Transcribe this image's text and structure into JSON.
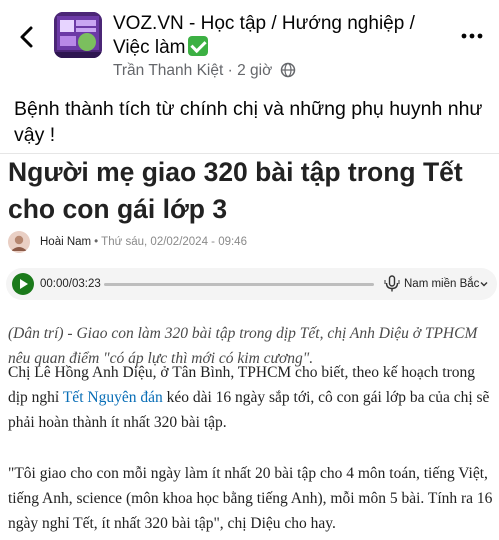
{
  "header": {
    "group_name": "VOZ.VN - Học tập / Hướng nghiệp / Việc làm",
    "author": "Trần Thanh Kiệt",
    "time": "2 giờ",
    "separator": "·"
  },
  "post": {
    "caption": "Bệnh thành tích từ chính chị và những phụ huynh như vậy !"
  },
  "article": {
    "title": "Người mẹ giao 320 bài tập trong Tết cho con gái lớp 3",
    "author": "Hoài Nam",
    "date": "Thứ sáu, 02/02/2024 - 09:46",
    "audio": {
      "time": "00:00/03:23",
      "voice": "Nam miền Bắc"
    },
    "lead": "(Dân trí) - Giao con làm 320 bài tập trong dịp Tết, chị Anh Diệu ở TPHCM nêu quan điểm \"có áp lực thì mới có kim cương\".",
    "p1_before": "Chị Lê Hồng Anh Diệu, ở Tân Bình, TPHCM cho biết, theo kế hoạch trong dịp nghỉ ",
    "p1_link": "Tết Nguyên đán",
    "p1_after": " kéo dài 16 ngày sắp tới, cô con gái lớp ba của chị sẽ phải hoàn thành ít nhất 320 bài tập.",
    "p2": "\"Tôi giao cho con mỗi ngày làm ít nhất 20 bài tập cho 4 môn toán, tiếng Việt, tiếng Anh, science (môn khoa học bằng tiếng Anh), mỗi môn 5 bài. Tính ra 16 ngày nghỉ Tết, ít nhất 320 bài tập\", chị Diệu cho hay."
  },
  "colors": {
    "link": "#076db6",
    "play": "#1b7a1b",
    "verified": "#3cb043"
  }
}
